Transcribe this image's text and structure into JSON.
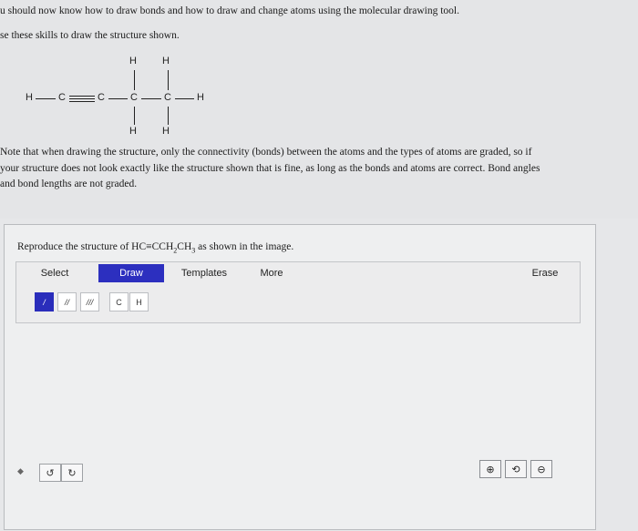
{
  "intro": {
    "line1": "u should now know how to draw bonds and how to draw and change atoms using the molecular drawing tool.",
    "line2": "se these skills to draw the structure shown."
  },
  "molecule_atoms": {
    "h_left": "H",
    "c1": "C",
    "c2": "C",
    "c3": "C",
    "c4": "C",
    "h_right": "H",
    "h_top1": "H",
    "h_top2": "H",
    "h_bot1": "H",
    "h_bot2": "H"
  },
  "note": {
    "line1": "Note that when drawing the structure, only the connectivity (bonds) between the atoms and the types of atoms are graded, so if",
    "line2": "your structure does not look exactly like the structure shown that is fine, as long as the bonds and atoms are correct. Bond angles",
    "line3": "and bond lengths are not graded."
  },
  "panel": {
    "prompt_pre": "Reproduce the structure of HC≡CCH",
    "prompt_sub1": "2",
    "prompt_mid": "CH",
    "prompt_sub2": "3",
    "prompt_post": " as shown in the image."
  },
  "tabs": {
    "select": "Select",
    "draw": "Draw",
    "templates": "Templates",
    "more": "More",
    "erase": "Erase"
  },
  "tools": {
    "single": "/",
    "double": "//",
    "triple": "///",
    "carbon": "C",
    "hydrogen": "H"
  },
  "controls": {
    "marker": "◆",
    "undo": "↺",
    "redo": "↻",
    "zoom_in": "⊕",
    "reset_zoom": "⟲",
    "zoom_out": "⊖"
  }
}
